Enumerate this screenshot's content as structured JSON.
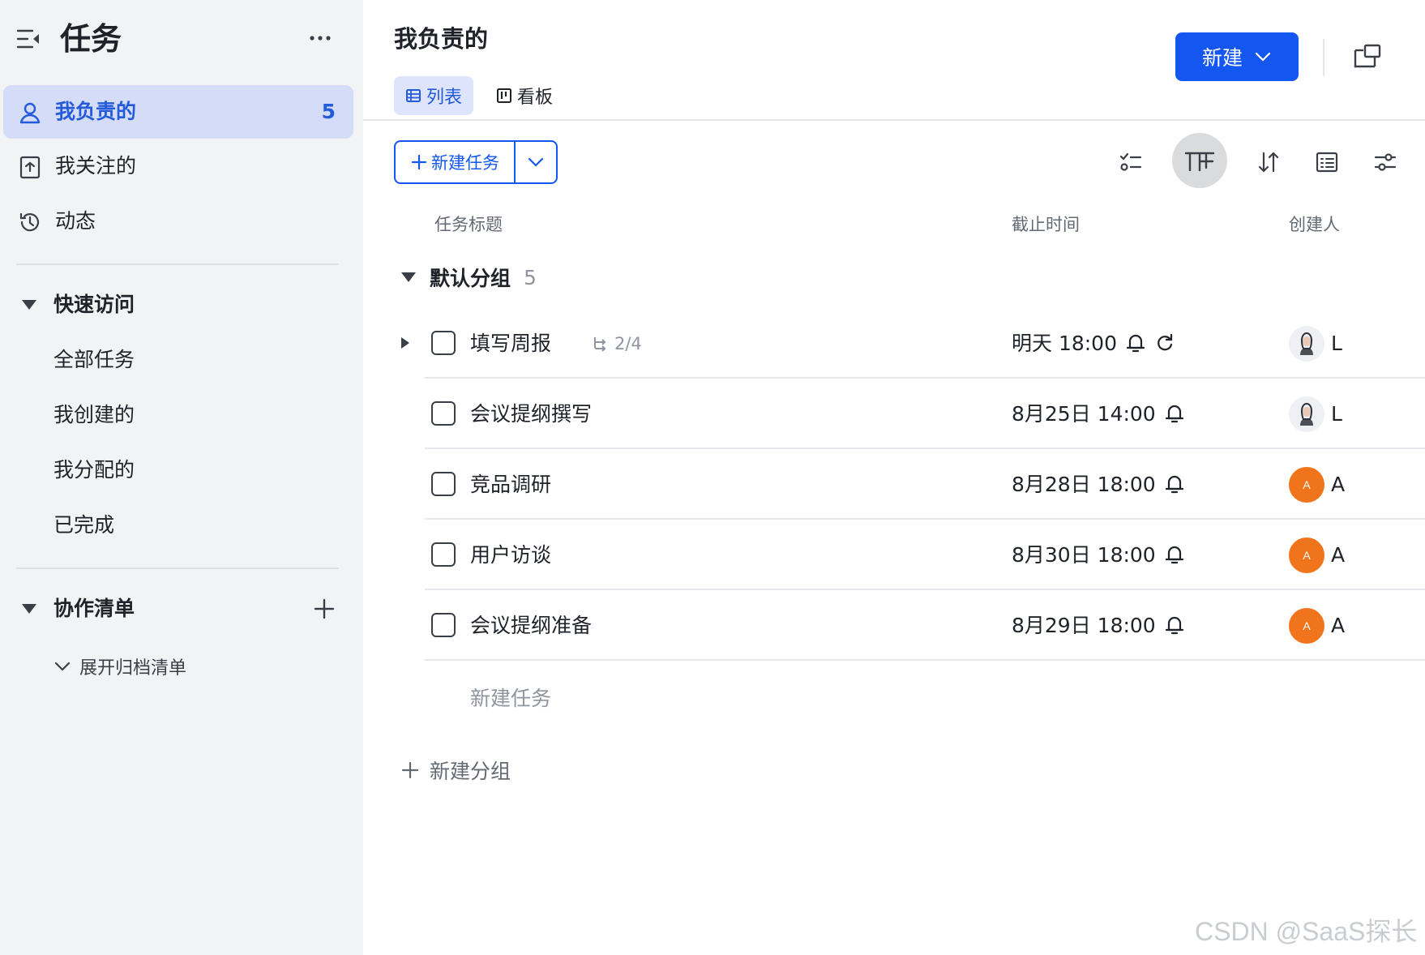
{
  "sidebar": {
    "title": "任务",
    "nav": [
      {
        "label": "我负责的",
        "count": "5"
      },
      {
        "label": "我关注的"
      },
      {
        "label": "动态"
      }
    ],
    "quick_access": {
      "label": "快速访问",
      "items": [
        "全部任务",
        "我创建的",
        "我分配的",
        "已完成"
      ]
    },
    "collab": {
      "label": "协作清单",
      "archive_label": "展开归档清单"
    }
  },
  "main": {
    "page_title": "我负责的",
    "view_tabs": [
      {
        "label": "列表",
        "active": true
      },
      {
        "label": "看板",
        "active": false
      }
    ],
    "new_button_label": "新建",
    "new_task_button_label": "新建任务",
    "columns": {
      "title": "任务标题",
      "due": "截止时间",
      "creator": "创建人"
    },
    "group": {
      "name": "默认分组",
      "count": "5"
    },
    "tasks": [
      {
        "title": "填写周报",
        "subtasks": "2/4",
        "due": "明天 18:00",
        "repeat": true,
        "avatar": "photo",
        "creator_initial": "L"
      },
      {
        "title": "会议提纲撰写",
        "due": "8月25日 14:00",
        "avatar": "photo",
        "creator_initial": "L"
      },
      {
        "title": "竞品调研",
        "due": "8月28日 18:00",
        "avatar": "orange",
        "avatar_letter": "A",
        "creator_initial": "A"
      },
      {
        "title": "用户访谈",
        "due": "8月30日 18:00",
        "avatar": "orange",
        "avatar_letter": "A",
        "creator_initial": "A"
      },
      {
        "title": "会议提纲准备",
        "due": "8月29日 18:00",
        "avatar": "orange",
        "avatar_letter": "A",
        "creator_initial": "A"
      }
    ],
    "new_task_inline": "新建任务",
    "new_group_label": "新建分组"
  },
  "colors": {
    "accent": "#1456f0",
    "active_nav_bg": "#d5dcf8",
    "avatar_orange": "#f0741c"
  },
  "icons": {
    "collapse": "sidebar-collapse-icon",
    "more": "more-icon",
    "person": "person-icon",
    "follow": "bookmark-icon",
    "activity": "history-icon",
    "bell": "bell-icon",
    "repeat": "repeat-icon",
    "subtask": "subtask-icon"
  },
  "watermark": "CSDN @SaaS探长"
}
